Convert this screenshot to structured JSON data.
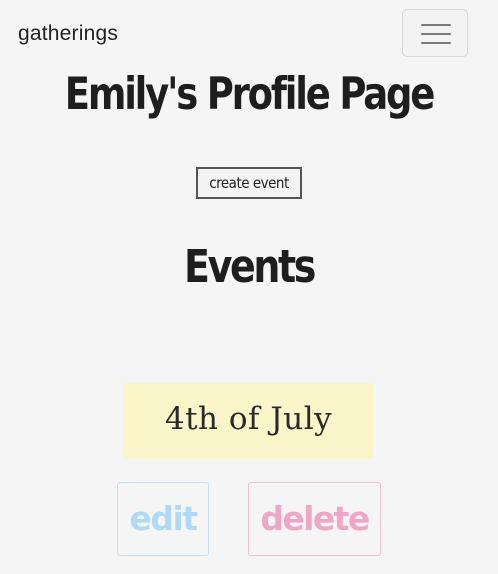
{
  "navbar": {
    "brand": "gatherings",
    "menu_icon": "hamburger-menu-icon"
  },
  "profile": {
    "title": "Emily's Profile Page",
    "create_event_label": "create event"
  },
  "events": {
    "heading": "Events",
    "items": [
      {
        "name": "4th of July",
        "edit_label": "edit",
        "delete_label": "delete"
      }
    ]
  },
  "colors": {
    "background": "#f5f5f5",
    "event_card": "#fbf6c9",
    "edit_accent": "#aedaf5",
    "delete_accent": "#f0a6c7"
  }
}
